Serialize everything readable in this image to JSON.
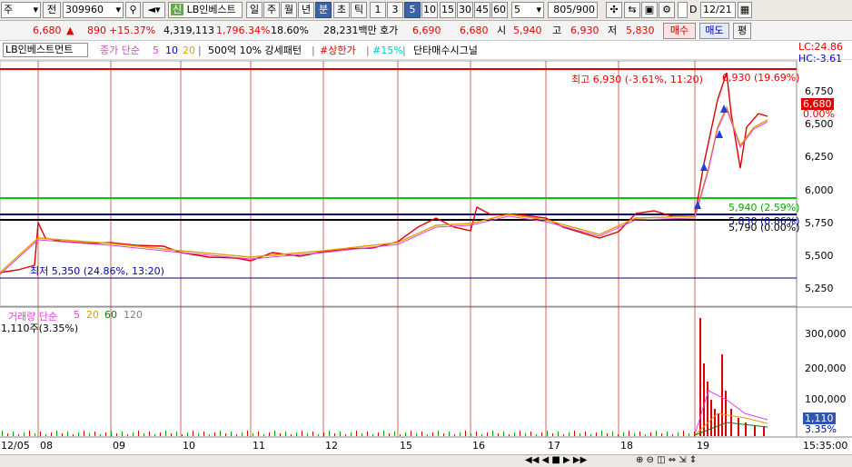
{
  "toolbar": {
    "market": "주",
    "prev": "전",
    "code": "309960",
    "credit_badge": "신",
    "name": "LB인베스트",
    "periods": [
      "일",
      "주",
      "월",
      "년",
      "분",
      "초",
      "틱"
    ],
    "intervals": [
      "1",
      "3",
      "5",
      "10",
      "15",
      "30",
      "45",
      "60"
    ],
    "interval_value": "5",
    "count": "805/900",
    "checkbox_label": "D",
    "date": "12/21"
  },
  "quote": {
    "price": "6,680",
    "change": "890",
    "change_pct": "+15.37%",
    "volume": "4,319,113",
    "vol_ratio": "1,796.34%",
    "turnover_ratio": "18.60%",
    "amount": "28,231백만",
    "ask_label": "호가",
    "ask1": "6,690",
    "ask2": "6,680",
    "open_label": "시",
    "open": "5,940",
    "high_label": "고",
    "high": "6,930",
    "low_label": "저",
    "low": "5,830",
    "buy": "매수",
    "sell": "매도",
    "eval": "평"
  },
  "legend": {
    "title": "LB인베스트먼트",
    "ma_label": "종가 단순",
    "ma5": "5",
    "ma10": "10",
    "ma20": "20",
    "pattern": "500억 10% 강세패턴",
    "upper_limit": "#상한가",
    "pct15": "#15%",
    "signal": "단타매수시그널",
    "lc": "LC:24.86",
    "hc": "HC:-3.61"
  },
  "price_axis": [
    "6,750",
    "6,500",
    "6,250",
    "6,000",
    "5,750",
    "5,500",
    "5,250"
  ],
  "price_labels": {
    "high_note": "최고 6,930 (-3.61%, 11:20)",
    "high_right": "6,930 (19.69%)",
    "current": "6,680",
    "current_pct": "0.00%",
    "line1": "5,940 (2.59%)",
    "line2": "5,830 (0.86%)",
    "line3": "5,790 (0.00%)",
    "low_note": "최저 5,350 (24.86%, 13:20)"
  },
  "volume": {
    "legend_label": "거래량 단순",
    "ma5": "5",
    "ma20": "20",
    "ma60": "60",
    "ma120": "120",
    "current": "1,110주(3.35%)",
    "axis": [
      "300,000",
      "200,000",
      "100,000"
    ],
    "box_value": "1,110",
    "box_pct": "3.35%"
  },
  "dates": [
    "12/05",
    "08",
    "09",
    "10",
    "11",
    "12",
    "15",
    "16",
    "17",
    "18",
    "19"
  ],
  "time": "15:35:00",
  "colors": {
    "up": "#e60000",
    "down": "#0000cc",
    "ma5": "#e040e0",
    "ma20": "#e0a000",
    "green": "#00cc00",
    "panel": "#ece9e4"
  }
}
